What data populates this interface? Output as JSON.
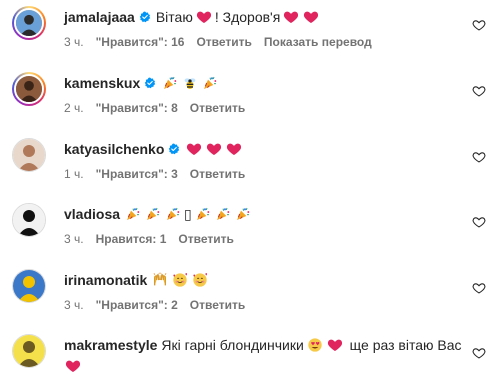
{
  "comments": [
    {
      "username": "jamalajaaa",
      "verified": true,
      "text_parts": [
        "Вітаю",
        "heart",
        "! Здоров'я",
        "heart",
        "heart"
      ],
      "time": "3 ч.",
      "likes": "\"Нравится\": 16",
      "reply": "Ответить",
      "translate": "Показать перевод"
    },
    {
      "username": "kamenskux",
      "verified": true,
      "text_parts": [
        "party",
        "bee",
        "party"
      ],
      "time": "2 ч.",
      "likes": "\"Нравится\": 8",
      "reply": "Ответить"
    },
    {
      "username": "katyasilchenko",
      "verified": true,
      "text_parts": [
        "heart",
        "heart",
        "heart"
      ],
      "time": "1 ч.",
      "likes": "\"Нравится\": 3",
      "reply": "Ответить"
    },
    {
      "username": "vladiosa",
      "verified": false,
      "text_parts": [
        "party",
        "party",
        "party",
        "▯",
        "party",
        "party",
        "party"
      ],
      "time": "3 ч.",
      "likes": "Нравится: 1",
      "reply": "Ответить"
    },
    {
      "username": "irinamonatik",
      "verified": false,
      "text_parts": [
        "raised-hands",
        "smile-hearts",
        "smile-hearts"
      ],
      "time": "3 ч.",
      "likes": "\"Нравится\": 2",
      "reply": "Ответить"
    },
    {
      "username": "makramestyle",
      "verified": false,
      "text_parts": [
        "Які гарні блондинчики",
        "heart-eyes",
        "heart",
        " ще раз вітаю Вас"
      ],
      "text_line2": [
        "heart"
      ]
    }
  ],
  "icons": {
    "verified_color": "#0095f6",
    "heart_color": "#e0245e",
    "like_button_icon": "heart-outline-icon"
  }
}
